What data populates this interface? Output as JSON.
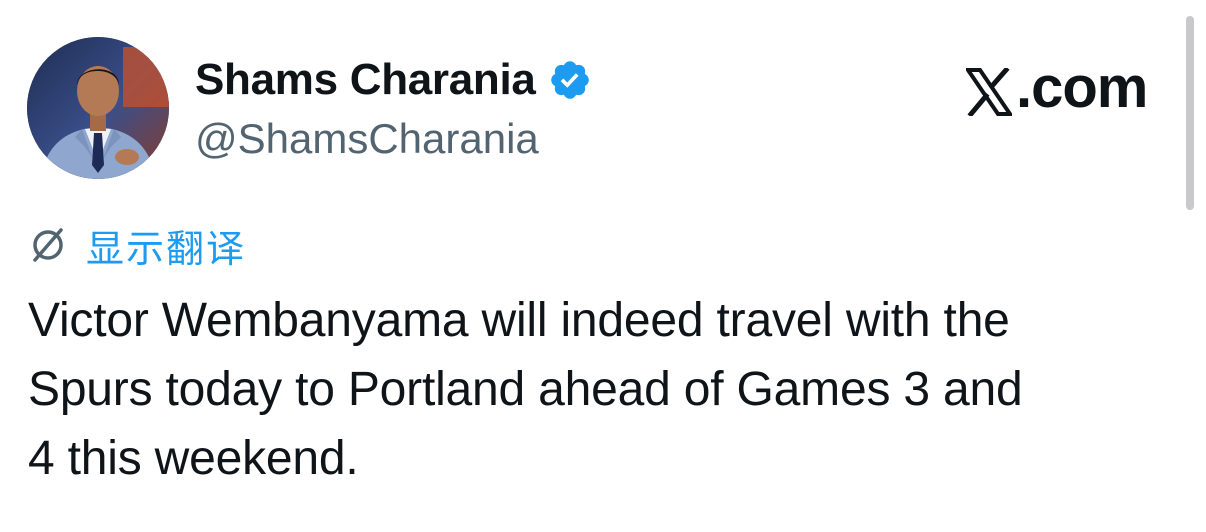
{
  "author": {
    "display_name": "Shams Charania",
    "handle": "@ShamsCharania",
    "avatar_icon": "profile-photo",
    "verified_icon": "verified-badge-icon",
    "verified_color": "#1d9bf0"
  },
  "brand": {
    "logo_icon": "x-logo-icon",
    "suffix": ".com"
  },
  "translate": {
    "icon": "globe-slash-icon",
    "label": "显示翻译",
    "color": "#1d9bf0"
  },
  "tweet": {
    "lines": [
      "Victor Wembanyama will indeed travel with the",
      "Spurs today to Portland ahead of Games 3 and",
      "4 this weekend."
    ]
  },
  "colors": {
    "text_primary": "#0f1419",
    "text_secondary": "#536471",
    "accent": "#1d9bf0",
    "background": "#ffffff"
  }
}
